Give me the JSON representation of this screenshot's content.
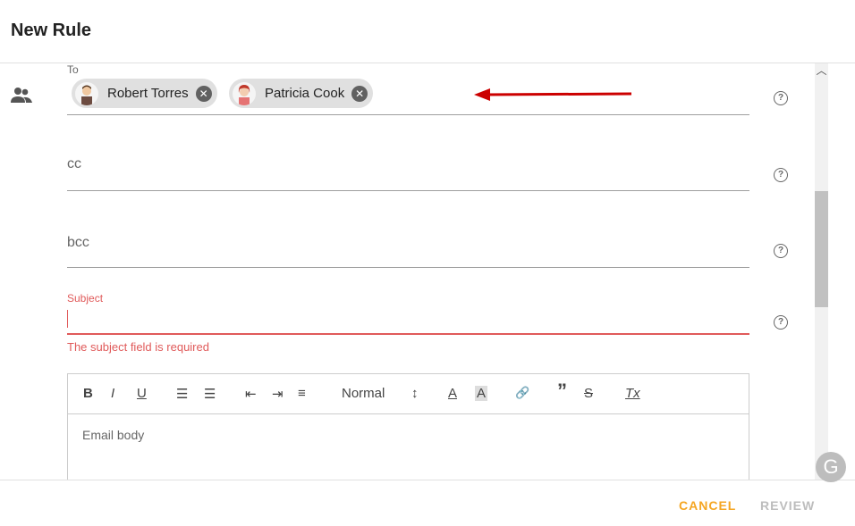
{
  "dialog": {
    "title": "New Rule"
  },
  "to": {
    "label": "To",
    "recipients": [
      {
        "name": "Robert Torres"
      },
      {
        "name": "Patricia Cook"
      }
    ]
  },
  "cc": {
    "placeholder": "cc"
  },
  "bcc": {
    "placeholder": "bcc"
  },
  "subject": {
    "label": "Subject",
    "value": "",
    "error": "The subject field is required"
  },
  "editor": {
    "toolbar": {
      "bold": "B",
      "italic": "I",
      "underline": "U",
      "ordered_list": "☰",
      "bullet_list": "☰",
      "outdent": "⇤",
      "indent": "⇥",
      "align": "≡",
      "format": "Normal",
      "format_arrows": "↕",
      "font_color": "A",
      "highlight": "A",
      "link": "🔗",
      "quote": "”",
      "strike": "S",
      "clear": "Tx"
    },
    "placeholder": "Email body"
  },
  "footer": {
    "cancel_label": "CANCEL",
    "review_label": "REVIEW"
  },
  "badge": {
    "letter": "G"
  },
  "colors": {
    "accent": "#f5a623",
    "error": "#e05a5a",
    "arrow": "#cc0000"
  }
}
